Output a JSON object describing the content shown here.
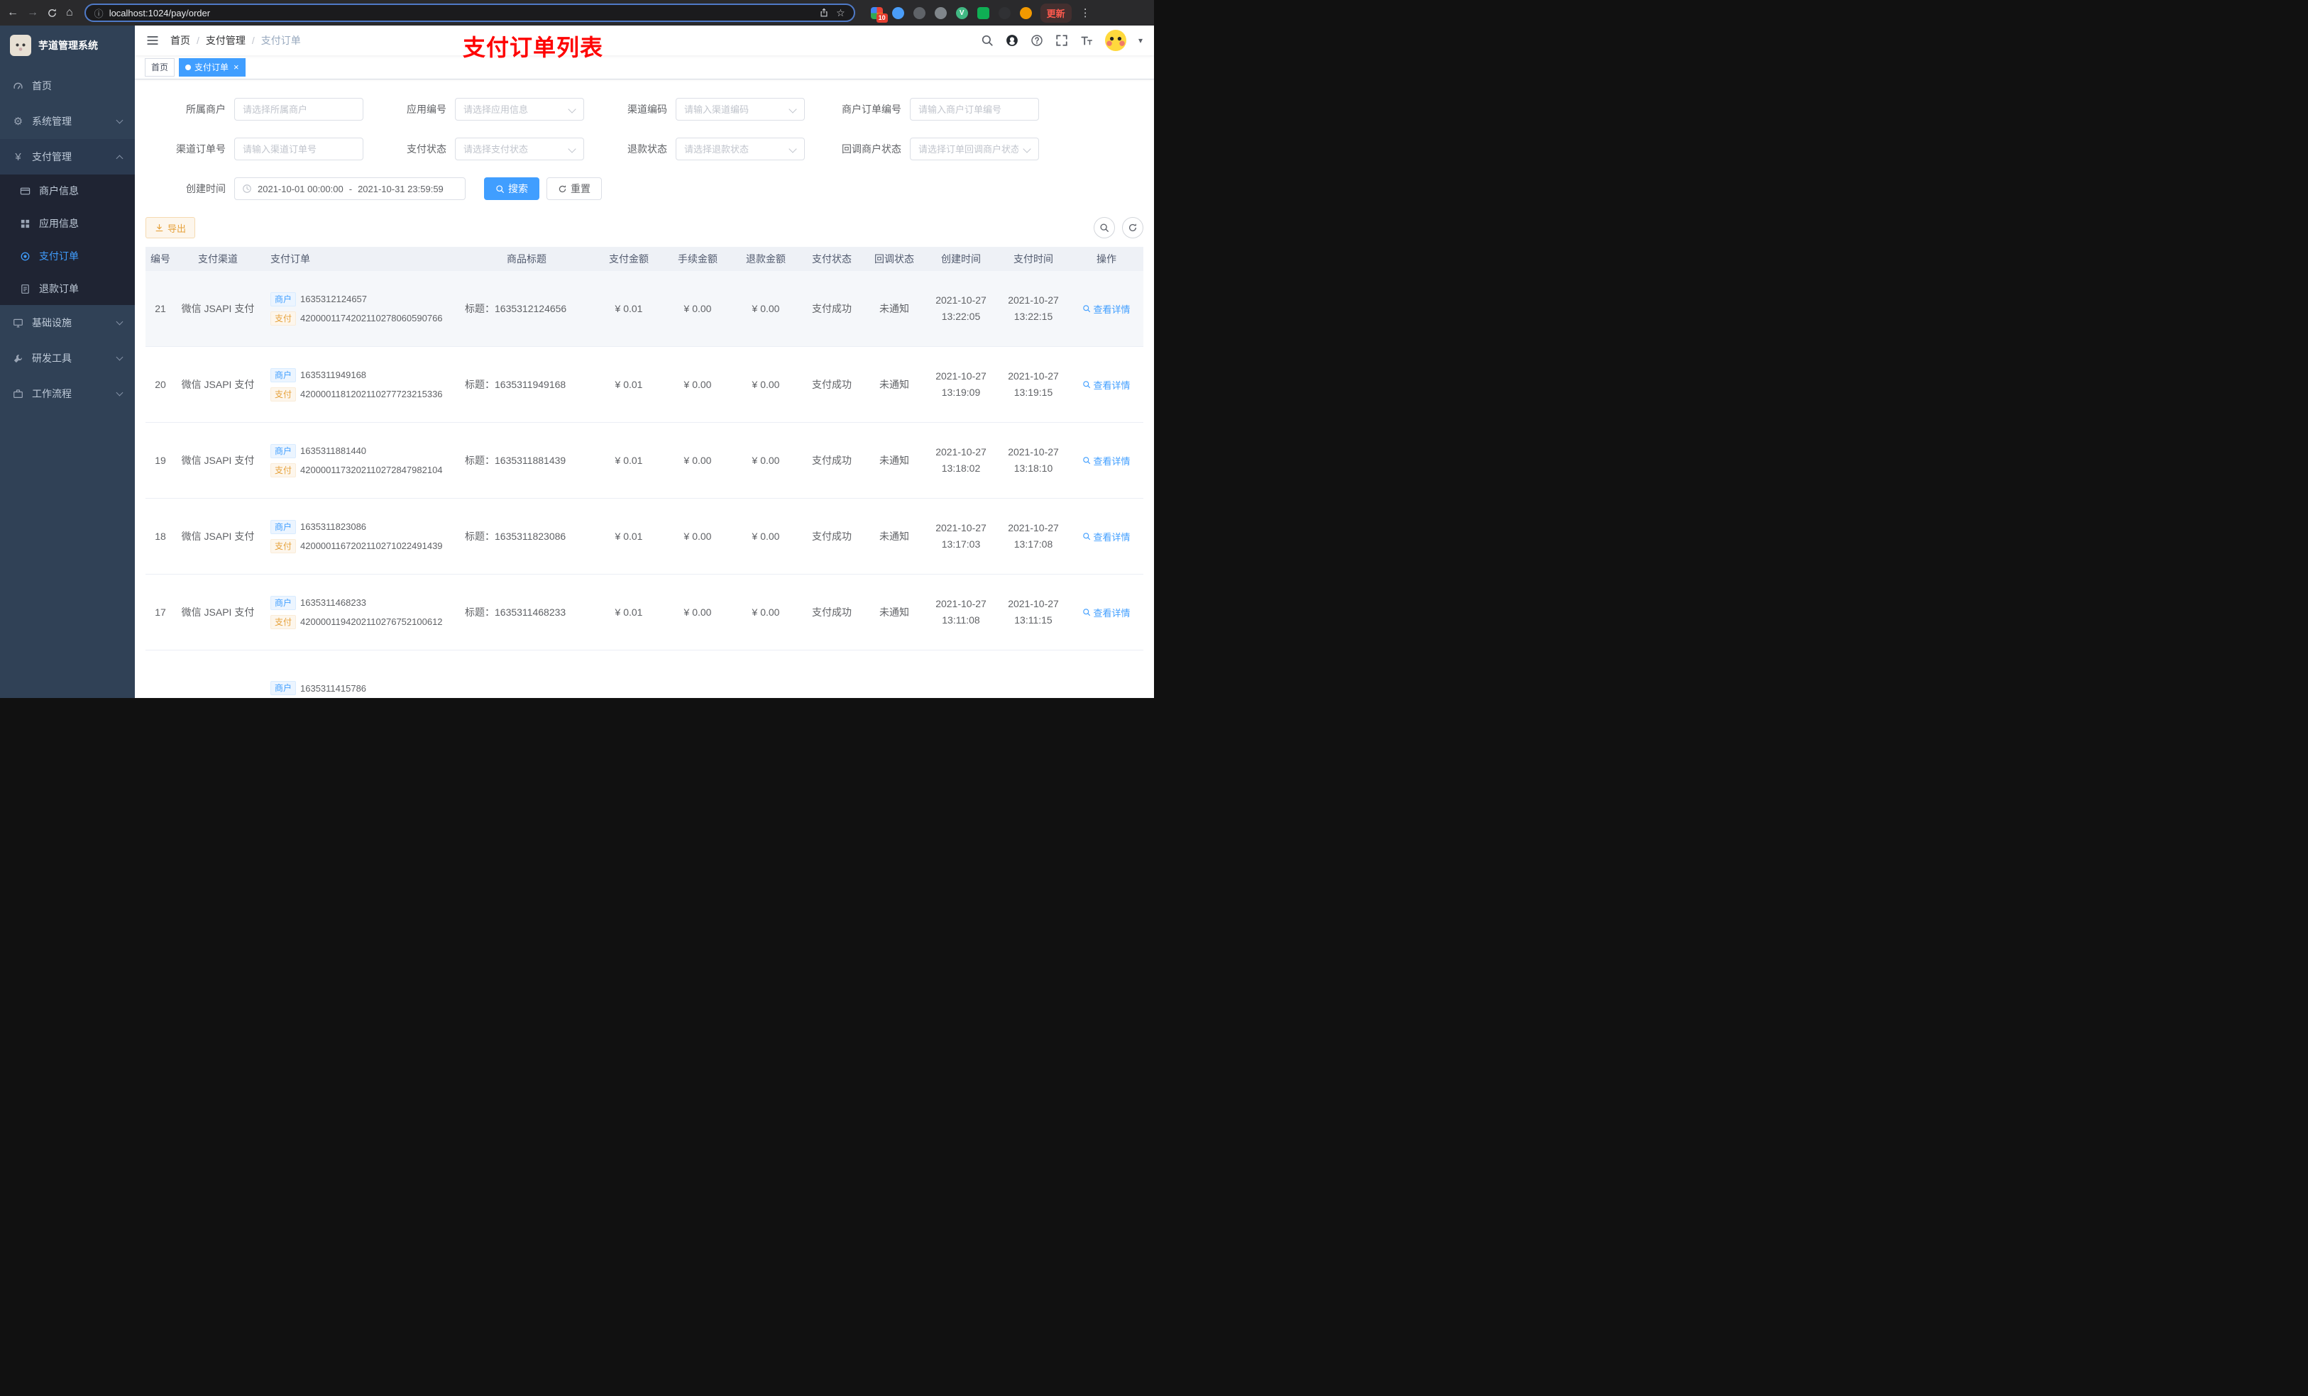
{
  "browser": {
    "url": "localhost:1024/pay/order",
    "update_label": "更新",
    "extension_badge": "10"
  },
  "icons": {
    "back": "←",
    "forward": "→",
    "home": "⌂",
    "info": "ⓘ",
    "star": "☆",
    "more": "⋮",
    "gear": "⚙",
    "yen": "¥",
    "close": "×",
    "caret": "▾",
    "separator": "/"
  },
  "colors": {
    "accent": "#409eff",
    "warning": "#e6a23c",
    "sidebar_bg": "#304156",
    "annotation": "#fe0303"
  },
  "sidebar": {
    "logo_title": "芋道管理系统",
    "items": [
      {
        "label": "首页"
      },
      {
        "label": "系统管理"
      },
      {
        "label": "支付管理",
        "children": [
          {
            "label": "商户信息"
          },
          {
            "label": "应用信息"
          },
          {
            "label": "支付订单"
          },
          {
            "label": "退款订单"
          }
        ]
      },
      {
        "label": "基础设施"
      },
      {
        "label": "研发工具"
      },
      {
        "label": "工作流程"
      }
    ]
  },
  "navbar": {
    "breadcrumb": [
      "首页",
      "支付管理",
      "支付订单"
    ],
    "annotation": "支付订单列表"
  },
  "tags_view": {
    "tabs": [
      {
        "label": "首页"
      },
      {
        "label": "支付订单"
      }
    ]
  },
  "filters": {
    "fields": [
      {
        "label": "所属商户",
        "placeholder": "请选择所属商户"
      },
      {
        "label": "应用编号",
        "placeholder": "请选择应用信息"
      },
      {
        "label": "渠道编码",
        "placeholder": "请输入渠道编码"
      },
      {
        "label": "商户订单编号",
        "placeholder": "请输入商户订单编号"
      },
      {
        "label": "渠道订单号",
        "placeholder": "请输入渠道订单号"
      },
      {
        "label": "支付状态",
        "placeholder": "请选择支付状态"
      },
      {
        "label": "退款状态",
        "placeholder": "请选择退款状态"
      },
      {
        "label": "回调商户状态",
        "placeholder": "请选择订单回调商户状态"
      }
    ],
    "date_label": "创建时间",
    "date_start": "2021-10-01 00:00:00",
    "date_end": "2021-10-31 23:59:59",
    "date_separator": "-",
    "search_label": "搜索",
    "reset_label": "重置"
  },
  "toolbar": {
    "export_label": "导出"
  },
  "table": {
    "columns": [
      "编号",
      "支付渠道",
      "支付订单",
      "商品标题",
      "支付金额",
      "手续金额",
      "退款金额",
      "支付状态",
      "回调状态",
      "创建时间",
      "支付时间",
      "操作"
    ],
    "merchant_tag": "商户",
    "pay_tag": "支付",
    "action_label": "查看详情",
    "rows": [
      {
        "id": "21",
        "channel": "微信 JSAPI 支付",
        "merchant_no": "1635312124657",
        "pay_no": "4200001174202110278060590766",
        "title": "标题：1635312124656",
        "amount": "¥ 0.01",
        "fee": "¥ 0.00",
        "refund": "¥ 0.00",
        "status": "支付成功",
        "notify": "未通知",
        "create_date": "2021-10-27",
        "create_time": "13:22:05",
        "pay_date": "2021-10-27",
        "pay_time": "13:22:15"
      },
      {
        "id": "20",
        "channel": "微信 JSAPI 支付",
        "merchant_no": "1635311949168",
        "pay_no": "4200001181202110277723215336",
        "title": "标题：1635311949168",
        "amount": "¥ 0.01",
        "fee": "¥ 0.00",
        "refund": "¥ 0.00",
        "status": "支付成功",
        "notify": "未通知",
        "create_date": "2021-10-27",
        "create_time": "13:19:09",
        "pay_date": "2021-10-27",
        "pay_time": "13:19:15"
      },
      {
        "id": "19",
        "channel": "微信 JSAPI 支付",
        "merchant_no": "1635311881440",
        "pay_no": "4200001173202110272847982104",
        "title": "标题：1635311881439",
        "amount": "¥ 0.01",
        "fee": "¥ 0.00",
        "refund": "¥ 0.00",
        "status": "支付成功",
        "notify": "未通知",
        "create_date": "2021-10-27",
        "create_time": "13:18:02",
        "pay_date": "2021-10-27",
        "pay_time": "13:18:10"
      },
      {
        "id": "18",
        "channel": "微信 JSAPI 支付",
        "merchant_no": "1635311823086",
        "pay_no": "4200001167202110271022491439",
        "title": "标题：1635311823086",
        "amount": "¥ 0.01",
        "fee": "¥ 0.00",
        "refund": "¥ 0.00",
        "status": "支付成功",
        "notify": "未通知",
        "create_date": "2021-10-27",
        "create_time": "13:17:03",
        "pay_date": "2021-10-27",
        "pay_time": "13:17:08"
      },
      {
        "id": "17",
        "channel": "微信 JSAPI 支付",
        "merchant_no": "1635311468233",
        "pay_no": "4200001194202110276752100612",
        "title": "标题：1635311468233",
        "amount": "¥ 0.01",
        "fee": "¥ 0.00",
        "refund": "¥ 0.00",
        "status": "支付成功",
        "notify": "未通知",
        "create_date": "2021-10-27",
        "create_time": "13:11:08",
        "pay_date": "2021-10-27",
        "pay_time": "13:11:15"
      },
      {
        "merchant_no": "1635311415786"
      }
    ]
  }
}
